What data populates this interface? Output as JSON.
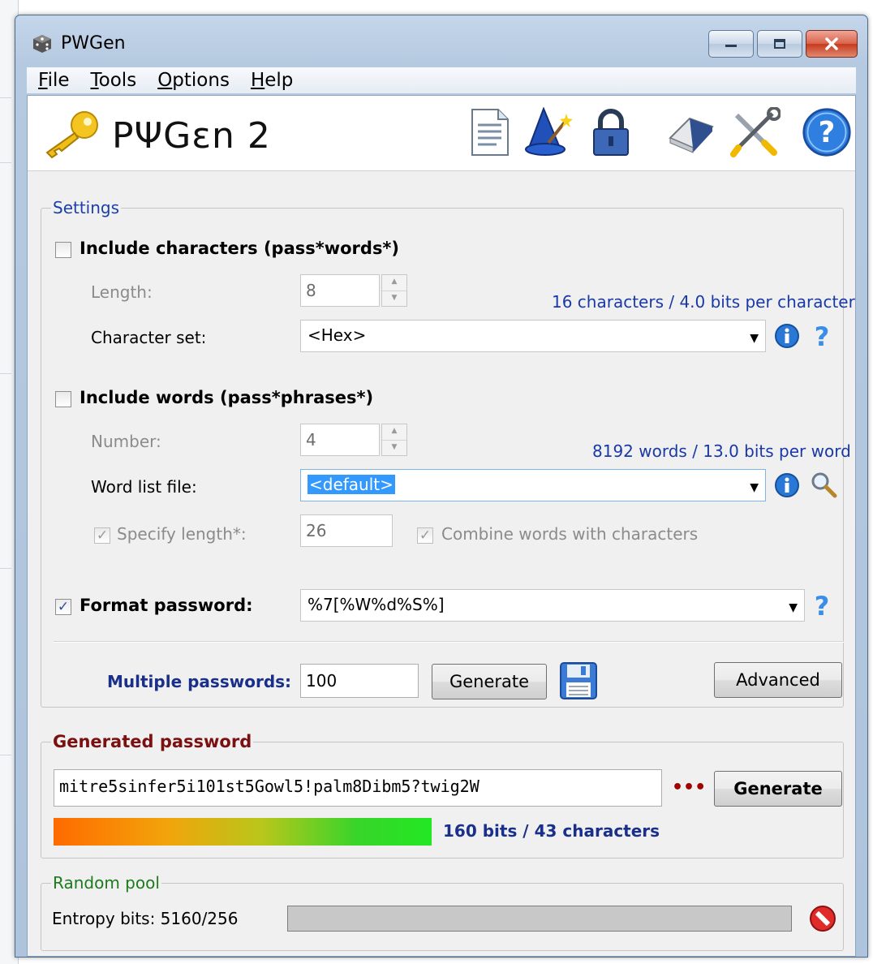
{
  "window": {
    "title": "PWGen",
    "minimize_icon": "minimize-icon",
    "maximize_icon": "maximize-icon",
    "close_icon": "close-icon"
  },
  "menu": {
    "items": [
      {
        "label_u": "F",
        "label_rest": "ile"
      },
      {
        "label_u": "T",
        "label_rest": "ools"
      },
      {
        "label_u": "O",
        "label_rest": "ptions"
      },
      {
        "label_u": "H",
        "label_rest": "elp"
      }
    ]
  },
  "header": {
    "app_name": "PΨGεn 2",
    "icons": [
      "key-icon",
      "document-icon",
      "wizard-icon",
      "padlock-icon",
      "eraser-icon",
      "tools-icon",
      "help-icon"
    ]
  },
  "settings": {
    "legend": "Settings",
    "include_chars": {
      "checked": false,
      "label": "Include characters (pass*words*)",
      "length_label": "Length:",
      "length_value": "8",
      "info": "16 characters / 4.0 bits per character",
      "charset_label": "Character set:",
      "charset_value": "<Hex>"
    },
    "include_words": {
      "checked": false,
      "label": "Include words (pass*phrases*)",
      "number_label": "Number:",
      "number_value": "4",
      "info": "8192 words / 13.0 bits per word",
      "wordlist_label": "Word list file:",
      "wordlist_value": "<default>",
      "specify_length_label": "Specify length*:",
      "specify_length_value": "26",
      "combine_label": "Combine words with characters"
    },
    "format": {
      "checked": true,
      "label": "Format password:",
      "value": "%7[%W%d%S%]"
    },
    "multiple": {
      "label": "Multiple passwords:",
      "value": "100",
      "generate_label": "Generate",
      "advanced_label": "Advanced"
    }
  },
  "generated": {
    "legend": "Generated password",
    "password": "mitre5sinfer5i101st5Gowl5!palm8Dibm5?twig2W",
    "dots": "•••",
    "generate_label": "Generate",
    "strength_text": "160 bits / 43 characters",
    "strength_fraction": 1.0
  },
  "pool": {
    "legend": "Random pool",
    "entropy_text": "Entropy bits: 5160/256",
    "fill_fraction": 1.0
  },
  "colors": {
    "accent_blue": "#1a39a8",
    "generated_legend": "#7a1010",
    "pool_legend": "#1d7a1d"
  }
}
